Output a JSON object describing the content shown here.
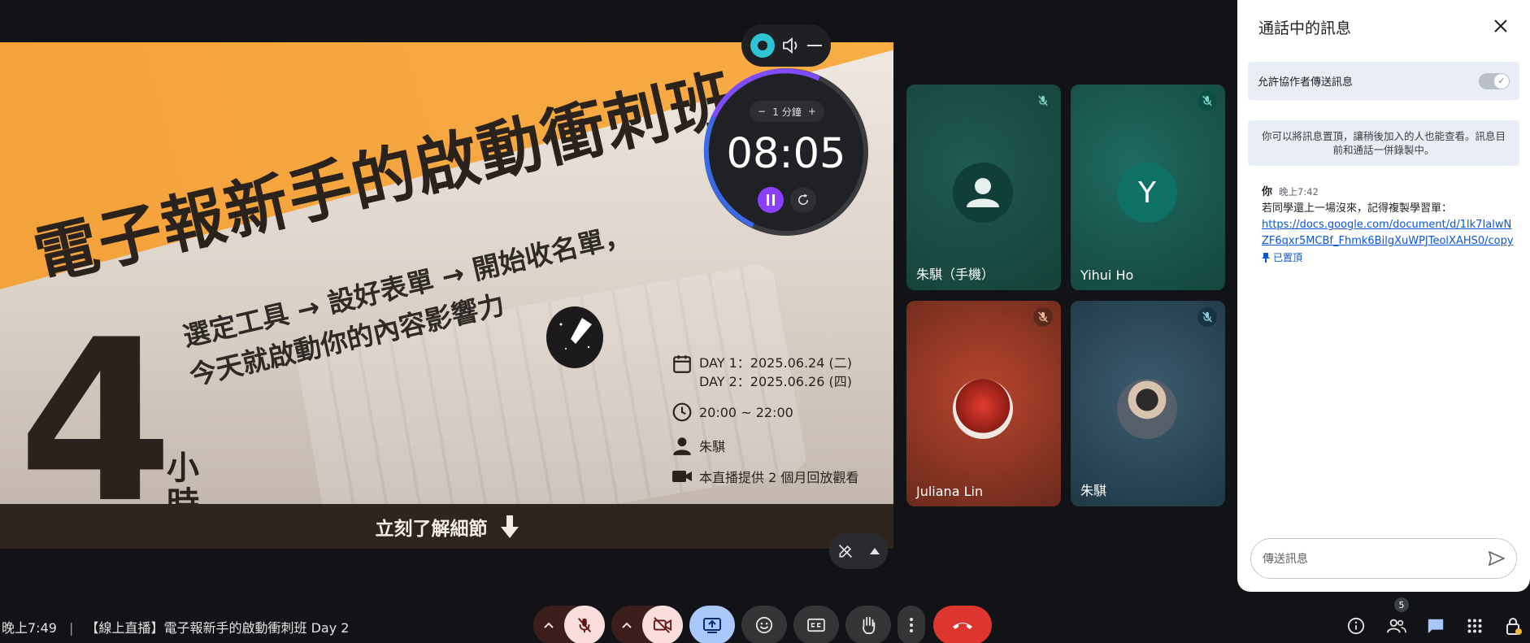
{
  "slide": {
    "title": "電子報新手的啟動衝刺班",
    "subtitle_line1": "選定工具 → 設好表單 → 開始收名單，",
    "subtitle_line2": "今天就啟動你的內容影響力",
    "hours_number": "4",
    "hours_unit": "小時",
    "day1": "DAY 1：2025.06.24 (二)",
    "day2": "DAY 2：2025.06.26 (四)",
    "time": "20:00 ~ 22:00",
    "host": "朱騏",
    "replay": "本直播提供 2 個月回放觀看",
    "cta": "立刻了解細節"
  },
  "timer": {
    "step_label": "1 分鐘",
    "minus": "−",
    "plus": "+",
    "display": "08:05",
    "progress_fraction": 0.35
  },
  "participants": [
    {
      "name": "朱騏（手機）",
      "avatar_letter": "",
      "muted": true
    },
    {
      "name": "Yihui Ho",
      "avatar_letter": "Y",
      "muted": true
    },
    {
      "name": "Juliana Lin",
      "avatar_letter": "",
      "muted": true
    },
    {
      "name": "朱騏",
      "avatar_letter": "",
      "muted": true
    }
  ],
  "chat": {
    "title": "通話中的訊息",
    "toggle_label": "允許協作者傳送訊息",
    "toggle_on": true,
    "note": "你可以將訊息置頂，讓稍後加入的人也能查看。訊息目前和通話一併錄製中。",
    "message": {
      "sender": "你",
      "time": "晚上7:42",
      "text": "若同學還上一場沒來，記得複製學習單：",
      "link": "https://docs.google.com/document/d/1lk7IalwNZF6qxr5MCBf_Fhmk6BilgXuWPJTeolXAHS0/copy",
      "pinned_label": "已置頂"
    },
    "input_placeholder": "傳送訊息"
  },
  "bottom_bar": {
    "clock": "晚上7:49",
    "separator": "|",
    "meeting_title": "【線上直播】電子報新手的啟動衝刺班 Day 2",
    "people_count": "5"
  },
  "colors": {
    "end_call": "#e3342f",
    "present_active": "#a8c7fa",
    "muted_bg": "#f9dedc",
    "chat_accent": "#0b57d0"
  }
}
